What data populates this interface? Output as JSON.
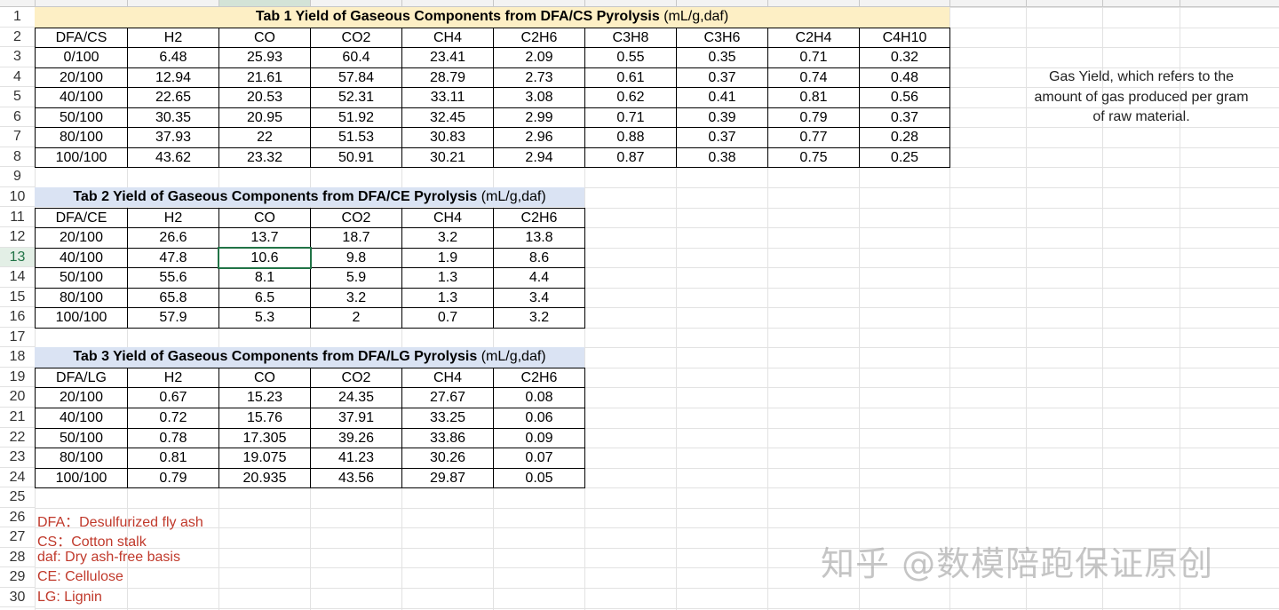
{
  "side_note": "Gas Yield, which refers to the amount of gas produced per gram of raw material.",
  "watermark": "知乎 @数模陪跑保证原创",
  "selected_cell": "C13",
  "row_numbers": [
    "1",
    "2",
    "3",
    "4",
    "5",
    "6",
    "7",
    "8",
    "9",
    "10",
    "11",
    "12",
    "13",
    "14",
    "15",
    "16",
    "17",
    "18",
    "19",
    "20",
    "21",
    "22",
    "23",
    "24",
    "25",
    "26",
    "27",
    "28",
    "29",
    "30"
  ],
  "table1": {
    "title_bold": "Tab 1 Yield of Gaseous Components from DFA/CS Pyrolysis",
    "title_unit": " (mL/g,daf)",
    "headers": [
      "DFA/CS",
      "H2",
      "CO",
      "CO2",
      "CH4",
      "C2H6",
      "C3H8",
      "C3H6",
      "C2H4",
      "C4H10"
    ],
    "rows": [
      [
        "0/100",
        "6.48",
        "25.93",
        "60.4",
        "23.41",
        "2.09",
        "0.55",
        "0.35",
        "0.71",
        "0.32"
      ],
      [
        "20/100",
        "12.94",
        "21.61",
        "57.84",
        "28.79",
        "2.73",
        "0.61",
        "0.37",
        "0.74",
        "0.48"
      ],
      [
        "40/100",
        "22.65",
        "20.53",
        "52.31",
        "33.11",
        "3.08",
        "0.62",
        "0.41",
        "0.81",
        "0.56"
      ],
      [
        "50/100",
        "30.35",
        "20.95",
        "51.92",
        "32.45",
        "2.99",
        "0.71",
        "0.39",
        "0.79",
        "0.37"
      ],
      [
        "80/100",
        "37.93",
        "22",
        "51.53",
        "30.83",
        "2.96",
        "0.88",
        "0.37",
        "0.77",
        "0.28"
      ],
      [
        "100/100",
        "43.62",
        "23.32",
        "50.91",
        "30.21",
        "2.94",
        "0.87",
        "0.38",
        "0.75",
        "0.25"
      ]
    ]
  },
  "table2": {
    "title_bold": "Tab 2 Yield of Gaseous Components from DFA/CE Pyrolysis",
    "title_unit": " (mL/g,daf)",
    "headers": [
      "DFA/CE",
      "H2",
      "CO",
      "CO2",
      "CH4",
      "C2H6"
    ],
    "rows": [
      [
        "20/100",
        "26.6",
        "13.7",
        "18.7",
        "3.2",
        "13.8"
      ],
      [
        "40/100",
        "47.8",
        "10.6",
        "9.8",
        "1.9",
        "8.6"
      ],
      [
        "50/100",
        "55.6",
        "8.1",
        "5.9",
        "1.3",
        "4.4"
      ],
      [
        "80/100",
        "65.8",
        "6.5",
        "3.2",
        "1.3",
        "3.4"
      ],
      [
        "100/100",
        "57.9",
        "5.3",
        "2",
        "0.7",
        "3.2"
      ]
    ]
  },
  "table3": {
    "title_bold": "Tab 3 Yield of Gaseous Components from DFA/LG Pyrolysis",
    "title_unit": " (mL/g,daf)",
    "headers": [
      "DFA/LG",
      "H2",
      "CO",
      "CO2",
      "CH4",
      "C2H6"
    ],
    "rows": [
      [
        "20/100",
        "0.67",
        "15.23",
        "24.35",
        "27.67",
        "0.08"
      ],
      [
        "40/100",
        "0.72",
        "15.76",
        "37.91",
        "33.25",
        "0.06"
      ],
      [
        "50/100",
        "0.78",
        "17.305",
        "39.26",
        "33.86",
        "0.09"
      ],
      [
        "80/100",
        "0.81",
        "19.075",
        "41.23",
        "30.26",
        "0.07"
      ],
      [
        "100/100",
        "0.79",
        "20.935",
        "43.56",
        "29.87",
        "0.05"
      ]
    ]
  },
  "notes": [
    "DFA：Desulfurized fly ash",
    "CS：Cotton stalk",
    "daf: Dry ash-free basis",
    "CE: Cellulose",
    "LG: Lignin"
  ],
  "colors": {
    "title1_bg": "#fdefc5",
    "title23_bg": "#dae3f3",
    "note_red": "#c0392b",
    "select_green": "#217346"
  }
}
